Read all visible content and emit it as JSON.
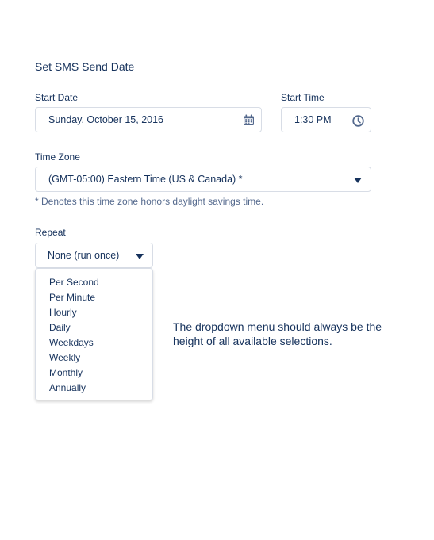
{
  "form": {
    "title": "Set SMS Send Date",
    "start_date": {
      "label": "Start Date",
      "value": "Sunday, October 15, 2016",
      "icon": "calendar-icon"
    },
    "start_time": {
      "label": "Start Time",
      "value": "1:30 PM",
      "icon": "clock-icon"
    },
    "time_zone": {
      "label": "Time Zone",
      "value": "(GMT-05:00) Eastern Time (US & Canada) *",
      "icon": "chevron-down-icon",
      "hint": "* Denotes this time zone honors daylight savings time."
    },
    "repeat": {
      "label": "Repeat",
      "value": "None (run once)",
      "icon": "chevron-down-icon",
      "options": [
        "Per Second",
        "Per Minute",
        "Hourly",
        "Daily",
        "Weekdays",
        "Weekly",
        "Monthly",
        "Annually"
      ]
    }
  },
  "note": "The dropdown menu should always be the height of all available selections.",
  "colors": {
    "text": "#16325c",
    "muted": "#54698d",
    "border": "#d8dde6",
    "icon": "#54698d"
  }
}
